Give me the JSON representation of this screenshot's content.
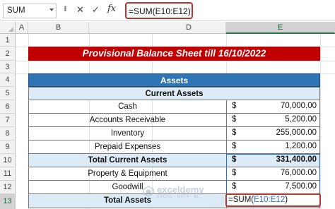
{
  "formula_bar": {
    "name_box": "SUM",
    "cancel_icon": "✕",
    "enter_icon": "✓",
    "fx_label": "fx",
    "formula": "=SUM(E10:E12)"
  },
  "columns": [
    "A",
    "B",
    "C",
    "D",
    "E"
  ],
  "selected_column": "E",
  "rows": [
    "1",
    "2",
    "3",
    "4",
    "5",
    "6",
    "7",
    "8",
    "9",
    "10",
    "11",
    "12",
    "13"
  ],
  "selected_row": "13",
  "sheet": {
    "title": "Provisional Balance Sheet till 16/10/2022",
    "section_header": "Assets",
    "subsection_header": "Current Assets",
    "items": [
      {
        "row": "6",
        "label": "Cash",
        "currency": "$",
        "amount": "70,000.00",
        "bold": false,
        "shade": false
      },
      {
        "row": "7",
        "label": "Accounts Receivable",
        "currency": "$",
        "amount": "5,200.00",
        "bold": false,
        "shade": false
      },
      {
        "row": "8",
        "label": "Inventory",
        "currency": "$",
        "amount": "255,000.00",
        "bold": false,
        "shade": false
      },
      {
        "row": "9",
        "label": "Prepaid Expenses",
        "currency": "$",
        "amount": "1,200.00",
        "bold": false,
        "shade": false
      },
      {
        "row": "10",
        "label": "Total Current Assets",
        "currency": "$",
        "amount": "331,400.00",
        "bold": true,
        "shade": true
      },
      {
        "row": "11",
        "label": "Property & Equipment",
        "currency": "$",
        "amount": "76,000.00",
        "bold": false,
        "shade": false
      },
      {
        "row": "12",
        "label": "Goodwill",
        "currency": "$",
        "amount": "7,500.00",
        "bold": false,
        "shade": false
      }
    ],
    "total_label": "Total Assets",
    "active_cell_prefix": "=SUM(",
    "active_cell_ref": "E10:E12",
    "active_cell_suffix": ")"
  },
  "watermark": {
    "name": "exceldemy",
    "tagline": "EXCEL · DATA · BI"
  },
  "colors": {
    "title_red": "#c00000",
    "header_blue": "#2e75b6",
    "light_blue": "#ddebf7",
    "highlight_red": "#b8352d",
    "ref_blue": "#2e6fcc"
  }
}
